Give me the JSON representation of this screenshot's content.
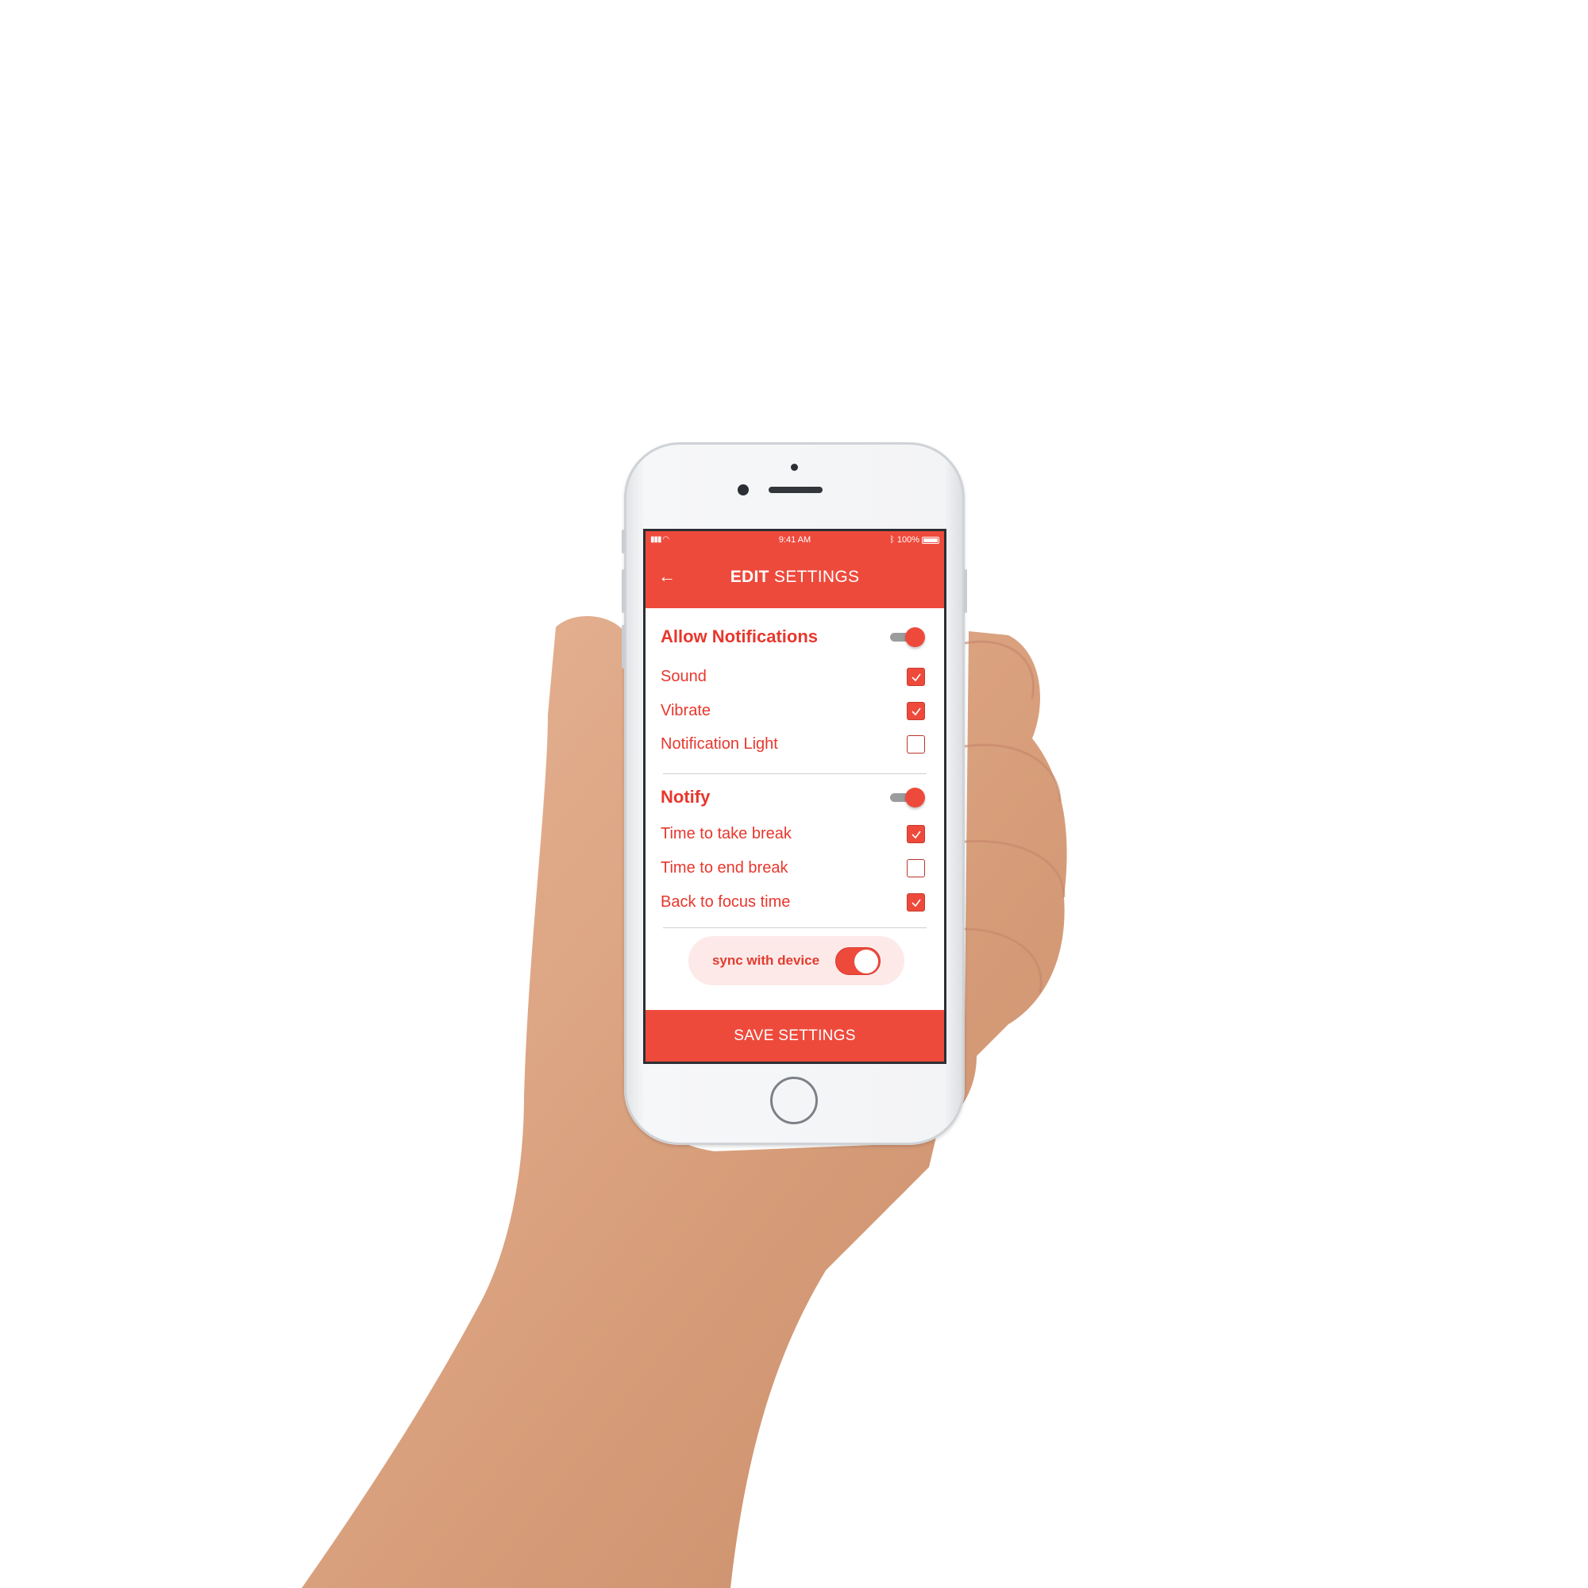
{
  "status_bar": {
    "signal_icon": "cellular-signal-icon",
    "wifi_icon": "wifi-icon",
    "time": "9:41 AM",
    "bluetooth_icon": "bluetooth-icon",
    "battery": "100%",
    "battery_icon": "battery-full-icon"
  },
  "header": {
    "back_icon": "arrow-left-icon",
    "title_bold": "EDIT",
    "title_rest": " SETTINGS"
  },
  "notifications": {
    "label": "Allow Notifications",
    "enabled": true,
    "items": [
      {
        "label": "Sound",
        "checked": true
      },
      {
        "label": "Vibrate",
        "checked": true
      },
      {
        "label": "Notification Light",
        "checked": false
      }
    ]
  },
  "notify": {
    "label": "Notify",
    "enabled": true,
    "items": [
      {
        "label": "Time to take break",
        "checked": true
      },
      {
        "label": "Time to end break",
        "checked": false
      },
      {
        "label": "Back to focus time",
        "checked": true
      }
    ]
  },
  "sync": {
    "label": "sync with device",
    "enabled": true
  },
  "footer": {
    "save_label": "SAVE SETTINGS"
  },
  "colors": {
    "accent": "#ee4a3c",
    "accent_text": "#e8372d",
    "sync_bg": "#fce9e8"
  }
}
